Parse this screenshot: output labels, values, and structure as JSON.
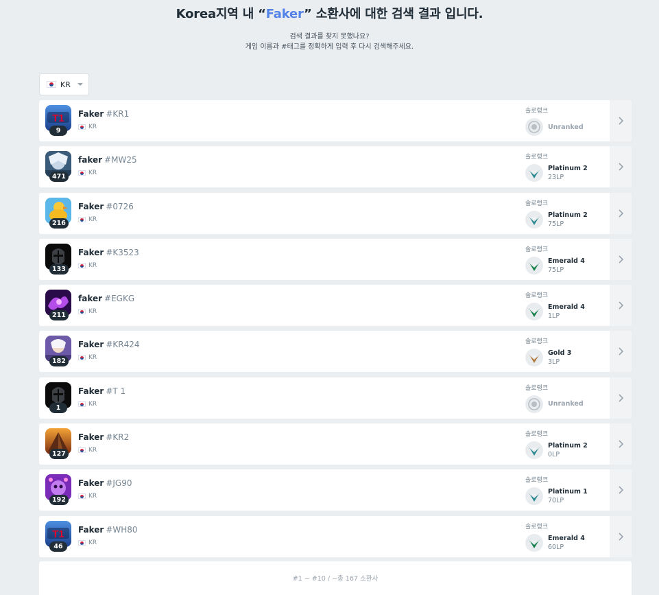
{
  "header": {
    "title_prefix": "Korea지역 내 “",
    "keyword": "Faker",
    "title_suffix": "” 소환사에 대한 검색 결과 입니다.",
    "line1": "검색 결과를 찾지 못했나요?",
    "line2": "게임 이름과 #태그를 정확하게 입력 후 다시 검색해주세요."
  },
  "region_select": {
    "value": "KR"
  },
  "queue_label": "솔로랭크",
  "players": [
    {
      "name": "Faker",
      "tag": "#KR1",
      "region": "KR",
      "level": "9",
      "tier": "Unranked",
      "lp": "",
      "avatar": "t1"
    },
    {
      "name": "faker",
      "tag": "#MW25",
      "region": "KR",
      "level": "471",
      "tier": "Platinum 2",
      "lp": "23LP",
      "avatar": "champ-blue"
    },
    {
      "name": "Faker",
      "tag": "#0726",
      "region": "KR",
      "level": "216",
      "tier": "Platinum 2",
      "lp": "75LP",
      "avatar": "duck"
    },
    {
      "name": "Faker",
      "tag": "#K3523",
      "region": "KR",
      "level": "133",
      "tier": "Emerald 4",
      "lp": "75LP",
      "avatar": "helmet"
    },
    {
      "name": "faker",
      "tag": "#EGKG",
      "region": "KR",
      "level": "211",
      "tier": "Emerald 4",
      "lp": "1LP",
      "avatar": "purple"
    },
    {
      "name": "Faker",
      "tag": "#KR424",
      "region": "KR",
      "level": "182",
      "tier": "Gold 3",
      "lp": "3LP",
      "avatar": "champ-white"
    },
    {
      "name": "Faker",
      "tag": "#T 1",
      "region": "KR",
      "level": "1",
      "tier": "Unranked",
      "lp": "",
      "avatar": "helmet"
    },
    {
      "name": "Faker",
      "tag": "#KR2",
      "region": "KR",
      "level": "127",
      "tier": "Platinum 2",
      "lp": "0LP",
      "avatar": "pyramid"
    },
    {
      "name": "Faker",
      "tag": "#JG90",
      "region": "KR",
      "level": "192",
      "tier": "Platinum 1",
      "lp": "70LP",
      "avatar": "poro"
    },
    {
      "name": "Faker",
      "tag": "#WH80",
      "region": "KR",
      "level": "46",
      "tier": "Emerald 4",
      "lp": "60LP",
      "avatar": "t1"
    }
  ],
  "tier_colors": {
    "Unranked": "#b8bec4",
    "Platinum": "#2b8a8f",
    "Emerald": "#14804a",
    "Gold": "#b07a3a"
  },
  "footer": {
    "range": "#1 ~ #10 / ~총 167 소환사"
  }
}
